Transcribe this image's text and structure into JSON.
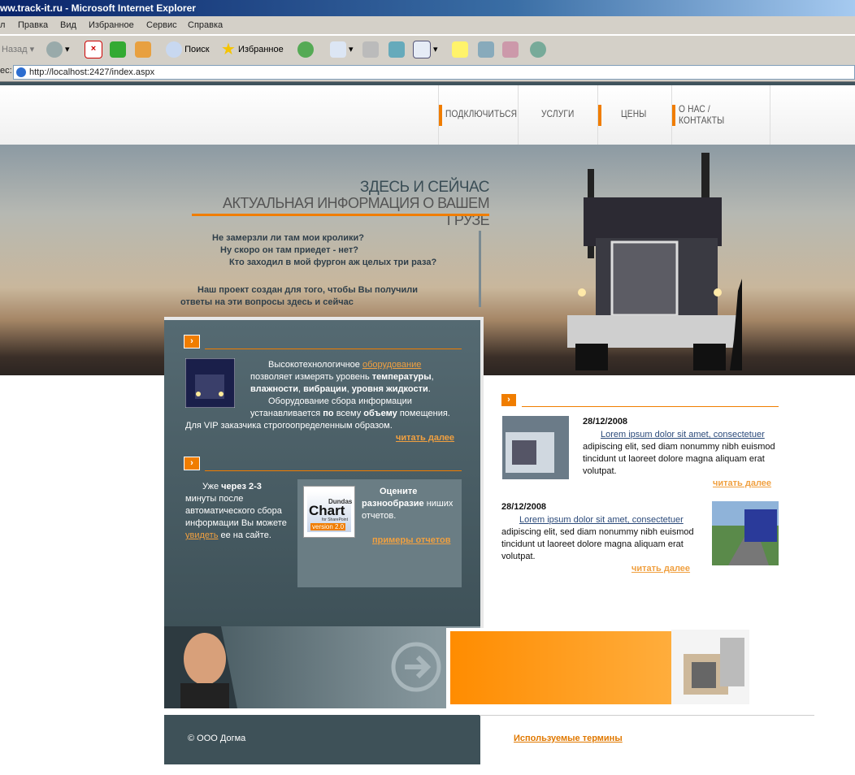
{
  "window": {
    "title": "ww.track-it.ru - Microsoft Internet Explorer"
  },
  "menu": [
    "л",
    "Правка",
    "Вид",
    "Избранное",
    "Сервис",
    "Справка"
  ],
  "toolbar": {
    "back": "Назад",
    "search": "Поиск",
    "favorites": "Избранное"
  },
  "address": {
    "label": "ес:",
    "url": "http://localhost:2427/index.aspx"
  },
  "nav": [
    {
      "label": "ПОДКЛЮЧИТЬСЯ"
    },
    {
      "label": "УСЛУГИ"
    },
    {
      "label": "ЦЕНЫ"
    },
    {
      "label": "О НАС /\nКОНТАКТЫ"
    }
  ],
  "hero": {
    "title1": "ЗДЕСЬ И СЕЙЧАС",
    "title2": "АКТУАЛЬНАЯ ИНФОРМАЦИЯ О ВАШЕМ ГРУЗЕ",
    "q1": "Не замерзли ли там мои кролики?",
    "q2": "Ну скоро он там приедет - нет?",
    "q3": "Кто заходил в мой фургон аж целых три раза?",
    "p1": "Наш проект создан для того, чтобы Вы получили",
    "p2": "ответы на эти вопросы здесь и сейчас"
  },
  "block1": {
    "arrow": "›",
    "t1": "Высокотехнологичное ",
    "link": "оборудование",
    "t2": "позволяет измерять уровень ",
    "b1": "температуры",
    "t3": ",",
    "b2": "влажности",
    "t4": ", ",
    "b3": "вибрации",
    "t5": ", ",
    "b4": "уровня жидкости",
    "t6": ".",
    "t7": "Оборудование сбора информации",
    "t8": "устанавливается ",
    "b5": "по",
    "t9": " всему ",
    "b6": "объему",
    "t10": " помещения.",
    "t11": "Для VIP заказчика строгоопределенным образом.",
    "more": "читать далее"
  },
  "block2": {
    "arrow": "›",
    "t1": "Уже ",
    "b1": "через 2-3",
    "t2": "минуты после",
    "t3": "автоматического сбора",
    "t4": "информации Вы можете",
    "link": "увидеть",
    "t5": " ее на сайте.",
    "r1": "Оцените",
    "r2": "разнообразие",
    "r3": " ниших",
    "r4": "отчетов.",
    "more": "примеры отчетов",
    "logo1": "Dundas",
    "logo2": "Chart",
    "logo3": "for SharePoint",
    "logo4": "version 2.0"
  },
  "news": {
    "arrow": "›",
    "items": [
      {
        "date": "28/12/2008",
        "link": "Lorem ipsum dolor sit amet, consectetuer",
        "l1": "adipiscing elit, sed diam nonummy nibh euismod",
        "l2": "tincidunt ut laoreet dolore magna aliquam erat",
        "l3": "volutpat.",
        "more": "читать далее"
      },
      {
        "date": "28/12/2008",
        "link": "Lorem ipsum dolor sit amet, consectetuer",
        "l1": "adipiscing elit, sed diam nonummy nibh euismod",
        "l2": "tincidunt ut laoreet dolore magna aliquam erat",
        "l3": "volutpat.",
        "more": "читать далее"
      }
    ]
  },
  "footer": {
    "copyright": "© ООО Догма",
    "terms": "Используемые термины"
  },
  "colors": {
    "accent": "#f07d00",
    "panel": "#3e5158",
    "link": "#f0a040"
  }
}
